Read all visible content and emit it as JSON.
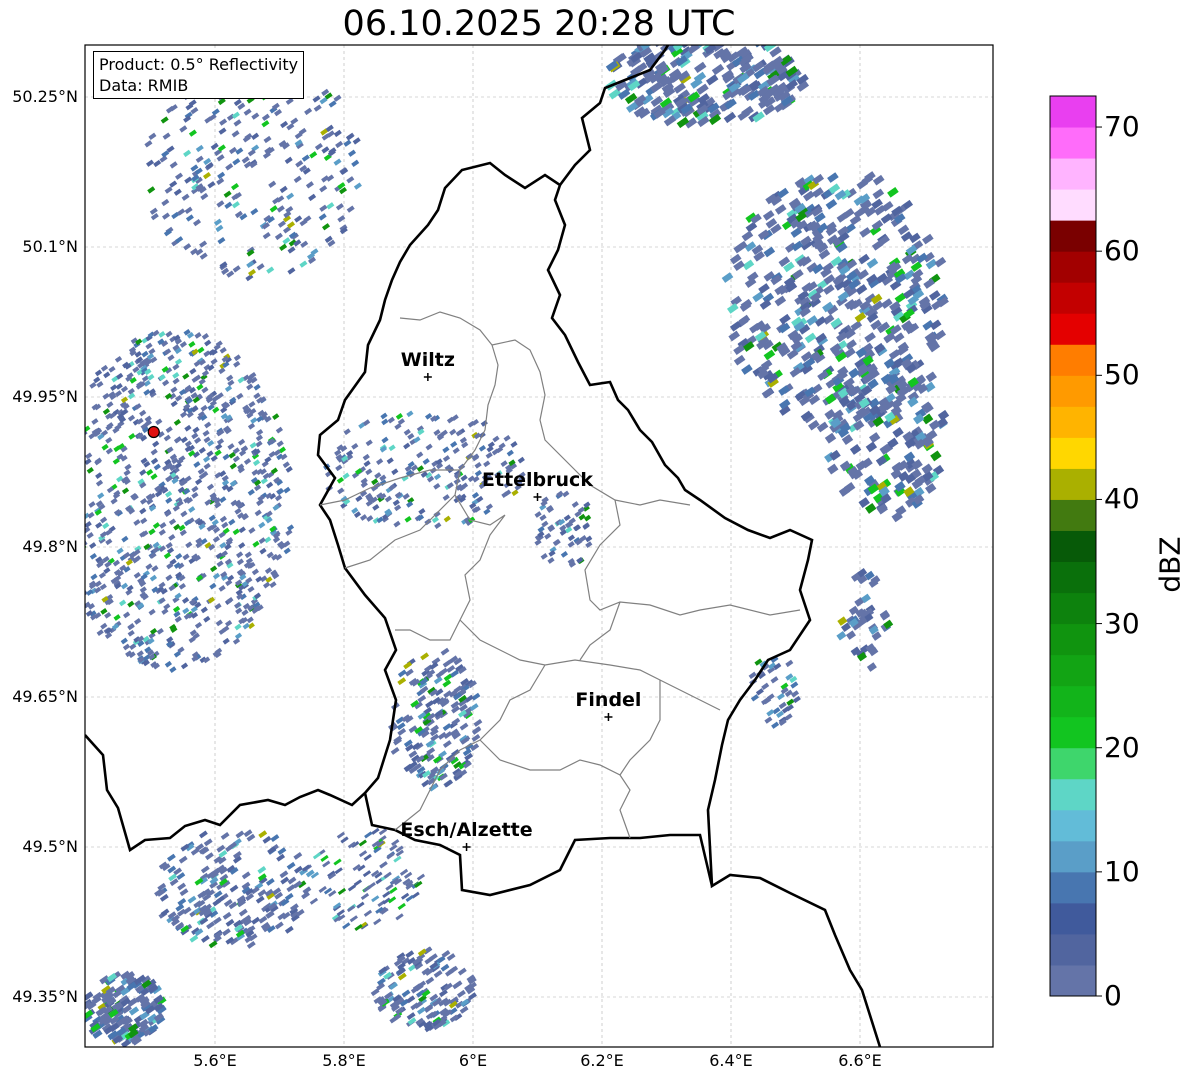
{
  "title": "06.10.2025 20:28 UTC",
  "info": {
    "product": "Product: 0.5° Reflectivity",
    "data": "Data: RMIB"
  },
  "axes": {
    "lon_ticks": [
      "5.6°E",
      "5.8°E",
      "6°E",
      "6.2°E",
      "6.4°E",
      "6.6°E"
    ],
    "lat_ticks": [
      "50.25°N",
      "50.1°N",
      "49.95°N",
      "49.8°N",
      "49.65°N",
      "49.5°N",
      "49.35°N"
    ]
  },
  "cities": [
    {
      "name": "Wiltz",
      "lon": 5.93,
      "lat": 49.97
    },
    {
      "name": "Ettelbruck",
      "lon": 6.1,
      "lat": 49.85
    },
    {
      "name": "Findel",
      "lon": 6.21,
      "lat": 49.63
    },
    {
      "name": "Esch/Alzette",
      "lon": 5.99,
      "lat": 49.5
    }
  ],
  "radar_site": {
    "lon": 5.505,
    "lat": 49.915,
    "color": "#e01010"
  },
  "colorbar": {
    "label": "dBZ",
    "ticks": [
      "0",
      "10",
      "20",
      "30",
      "40",
      "50",
      "60",
      "70"
    ],
    "colors": [
      "#6474a8",
      "#51659f",
      "#405a9c",
      "#4876b0",
      "#5a9ec8",
      "#62bcd8",
      "#5ed6c6",
      "#3ed66c",
      "#12c520",
      "#12b41a",
      "#12a414",
      "#10940f",
      "#0d820d",
      "#0a700b",
      "#075a08",
      "#427a10",
      "#aab000",
      "#ffd700",
      "#ffb400",
      "#ff9a00",
      "#ff7d00",
      "#e40000",
      "#c30000",
      "#a20000",
      "#7a0000",
      "#ffdcff",
      "#ffb4ff",
      "#ff6cfa",
      "#e93ff0"
    ]
  }
}
